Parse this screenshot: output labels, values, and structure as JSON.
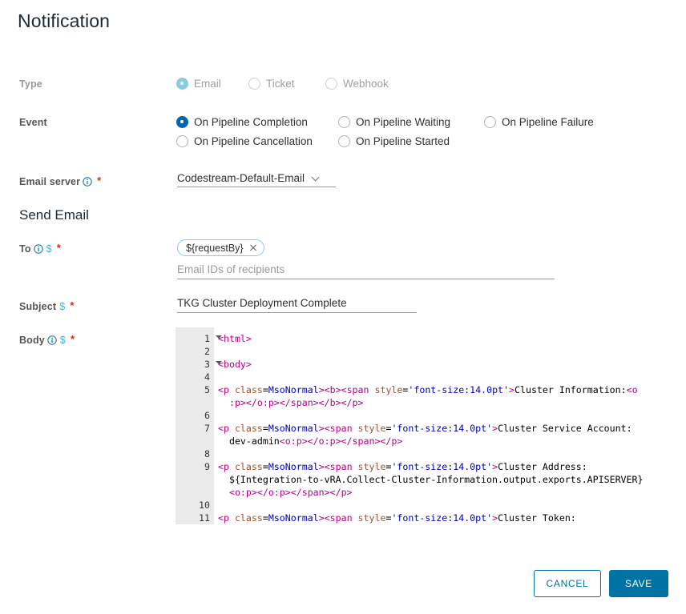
{
  "page": {
    "title": "Notification"
  },
  "type_row": {
    "label": "Type",
    "disabled": true,
    "options": [
      {
        "label": "Email",
        "checked": true
      },
      {
        "label": "Ticket",
        "checked": false
      },
      {
        "label": "Webhook",
        "checked": false
      }
    ]
  },
  "event_row": {
    "label": "Event",
    "options": [
      {
        "label": "On Pipeline Completion",
        "checked": true
      },
      {
        "label": "On Pipeline Waiting",
        "checked": false
      },
      {
        "label": "On Pipeline Failure",
        "checked": false
      },
      {
        "label": "On Pipeline Cancellation",
        "checked": false
      },
      {
        "label": "On Pipeline Started",
        "checked": false
      }
    ]
  },
  "email_server": {
    "label": "Email server",
    "required_marker": "*",
    "value": "Codestream-Default-Email"
  },
  "send_email_header": "Send Email",
  "to_field": {
    "label": "To",
    "required_marker": "*",
    "dollar": "$",
    "chip": "${requestBy}",
    "placeholder": "Email IDs of recipients"
  },
  "subject_field": {
    "label": "Subject",
    "required_marker": "*",
    "dollar": "$",
    "value": "TKG Cluster Deployment Complete"
  },
  "body_field": {
    "label": "Body",
    "required_marker": "*",
    "dollar": "$"
  },
  "editor": {
    "gutter": [
      {
        "num": "1",
        "fold": true
      },
      {
        "num": "2",
        "fold": false
      },
      {
        "num": "3",
        "fold": true
      },
      {
        "num": "4",
        "fold": false
      },
      {
        "num": "5",
        "fold": false
      },
      {
        "num": "",
        "fold": false
      },
      {
        "num": "6",
        "fold": false
      },
      {
        "num": "7",
        "fold": false
      },
      {
        "num": "",
        "fold": false
      },
      {
        "num": "8",
        "fold": false
      },
      {
        "num": "9",
        "fold": false
      },
      {
        "num": "",
        "fold": false
      },
      {
        "num": "",
        "fold": false
      },
      {
        "num": "10",
        "fold": false
      },
      {
        "num": "11",
        "fold": false
      }
    ],
    "lines": [
      [
        {
          "t": "<html>",
          "c": "tg"
        }
      ],
      [],
      [
        {
          "t": "<body>",
          "c": "tg"
        }
      ],
      [],
      [
        {
          "t": "<p ",
          "c": "tg"
        },
        {
          "t": "class",
          "c": "at"
        },
        {
          "t": "=",
          "c": "tx"
        },
        {
          "t": "MsoNormal",
          "c": "vl"
        },
        {
          "t": "><b><span ",
          "c": "tg"
        },
        {
          "t": "style",
          "c": "at"
        },
        {
          "t": "=",
          "c": "tx"
        },
        {
          "t": "'font-size:14.0pt'",
          "c": "vl"
        },
        {
          "t": ">",
          "c": "tg"
        },
        {
          "t": "Cluster Information:",
          "c": "tx"
        },
        {
          "t": "<o",
          "c": "tg"
        }
      ],
      [
        {
          "t": "  ",
          "c": "tx"
        },
        {
          "t": ":p></o:p></span></b></p>",
          "c": "tg"
        }
      ],
      [],
      [
        {
          "t": "<p ",
          "c": "tg"
        },
        {
          "t": "class",
          "c": "at"
        },
        {
          "t": "=",
          "c": "tx"
        },
        {
          "t": "MsoNormal",
          "c": "vl"
        },
        {
          "t": "><span ",
          "c": "tg"
        },
        {
          "t": "style",
          "c": "at"
        },
        {
          "t": "=",
          "c": "tx"
        },
        {
          "t": "'font-size:14.0pt'",
          "c": "vl"
        },
        {
          "t": ">",
          "c": "tg"
        },
        {
          "t": "Cluster Service Account:",
          "c": "tx"
        }
      ],
      [
        {
          "t": "  dev-admin",
          "c": "tx"
        },
        {
          "t": "<o:p></o:p></span></p>",
          "c": "tg"
        }
      ],
      [],
      [
        {
          "t": "<p ",
          "c": "tg"
        },
        {
          "t": "class",
          "c": "at"
        },
        {
          "t": "=",
          "c": "tx"
        },
        {
          "t": "MsoNormal",
          "c": "vl"
        },
        {
          "t": "><span ",
          "c": "tg"
        },
        {
          "t": "style",
          "c": "at"
        },
        {
          "t": "=",
          "c": "tx"
        },
        {
          "t": "'font-size:14.0pt'",
          "c": "vl"
        },
        {
          "t": ">",
          "c": "tg"
        },
        {
          "t": "Cluster Address:",
          "c": "tx"
        }
      ],
      [
        {
          "t": "  ${Integration-to-vRA.Collect-Cluster-Information.output.exports.APISERVER}",
          "c": "tx"
        }
      ],
      [
        {
          "t": "  ",
          "c": "tx"
        },
        {
          "t": "<o:p></o:p></span></p>",
          "c": "tg"
        }
      ],
      [],
      [
        {
          "t": "<p ",
          "c": "tg"
        },
        {
          "t": "class",
          "c": "at"
        },
        {
          "t": "=",
          "c": "tx"
        },
        {
          "t": "MsoNormal",
          "c": "vl"
        },
        {
          "t": "><span ",
          "c": "tg"
        },
        {
          "t": "style",
          "c": "at"
        },
        {
          "t": "=",
          "c": "tx"
        },
        {
          "t": "'font-size:14.0pt'",
          "c": "vl"
        },
        {
          "t": ">",
          "c": "tg"
        },
        {
          "t": "Cluster Token:",
          "c": "tx"
        }
      ]
    ]
  },
  "footer": {
    "cancel_label": "CANCEL",
    "save_label": "SAVE"
  },
  "colors": {
    "accent": "#0072a3",
    "radio_checked": "#0065ab",
    "radio_disabled": "#89cbdf",
    "required": "#e62700",
    "info": "#0072a3",
    "dollar": "#49afd9"
  }
}
